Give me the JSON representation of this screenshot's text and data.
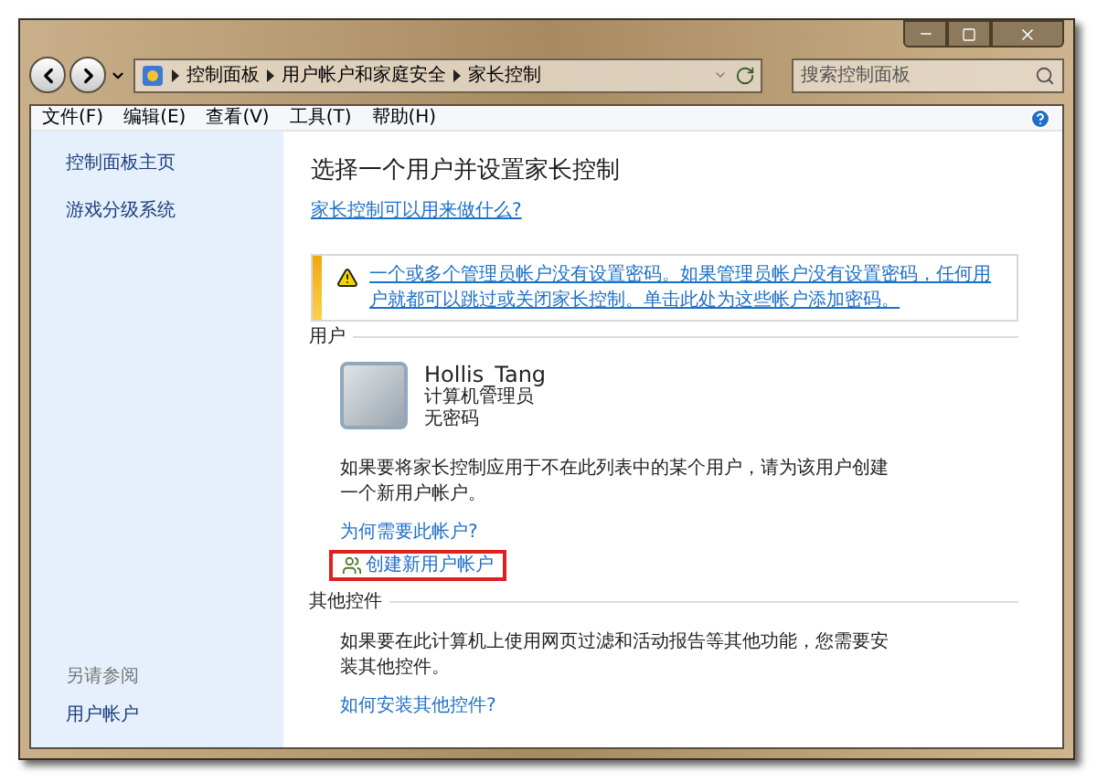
{
  "breadcrumb": [
    "控制面板",
    "用户帐户和家庭安全",
    "家长控制"
  ],
  "search": {
    "placeholder": "搜索控制面板"
  },
  "menu": [
    "文件(F)",
    "编辑(E)",
    "查看(V)",
    "工具(T)",
    "帮助(H)"
  ],
  "sidebar": {
    "items": [
      "控制面板主页",
      "游戏分级系统"
    ],
    "see_also_title": "另请参阅",
    "see_also": [
      "用户帐户"
    ]
  },
  "main": {
    "title": "选择一个用户并设置家长控制",
    "help_link": "家长控制可以用来做什么?",
    "warning": "一个或多个管理员帐户没有设置密码。如果管理员帐户没有设置密码，任何用户就都可以跳过或关闭家长控制。单击此处为这些帐户添加密码。",
    "users_heading": "用户",
    "user": {
      "name": "Hollis_Tang",
      "role": "计算机管理员",
      "password_status": "无密码"
    },
    "note": "如果要将家长控制应用于不在此列表中的某个用户，请为该用户创建一个新用户帐户。",
    "why_link": "为何需要此帐户?",
    "create_link": {
      "label": "创建新用户帐户",
      "highlighted": true
    },
    "other_heading": "其他控件",
    "other_text": "如果要在此计算机上使用网页过滤和活动报告等其他功能，您需要安装其他控件。",
    "other_link": "如何安装其他控件?"
  }
}
